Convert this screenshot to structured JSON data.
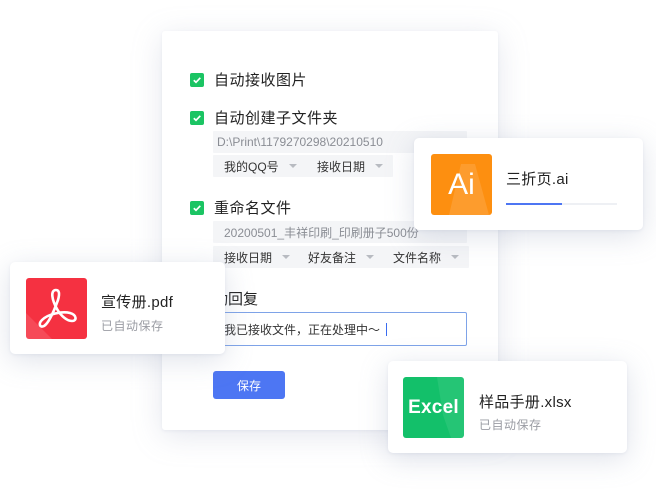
{
  "settings": {
    "auto_receive_images": {
      "label": "自动接收图片",
      "checked": true
    },
    "auto_create_subfolder": {
      "label": "自动创建子文件夹",
      "checked": true,
      "path_value": "D:\\Print\\1179270298\\20210510",
      "dropdowns": [
        {
          "label": "我的QQ号"
        },
        {
          "label": "接收日期"
        }
      ]
    },
    "rename_file": {
      "label": "重命名文件",
      "checked": true,
      "name_preview": "20200501_丰祥印刷_印刷册子500份",
      "dropdowns": [
        {
          "label": "接收日期"
        },
        {
          "label": "好友备注"
        },
        {
          "label": "文件名称"
        }
      ]
    },
    "auto_reply": {
      "label": "自动回复",
      "input_value": "我已接收文件，正在处理中～"
    },
    "save_label": "保存"
  },
  "files": {
    "ai": {
      "name": "三折页.ai",
      "icon_text": "Ai",
      "progress": 0.5,
      "color": "#fd8f10"
    },
    "pdf": {
      "name": "宣传册.pdf",
      "status": "已自动保存",
      "color": "#f53141"
    },
    "xlsx": {
      "name": "样品手册.xlsx",
      "icon_text": "Excel",
      "status": "已自动保存",
      "color": "#13c06a"
    }
  },
  "colors": {
    "checkbox": "#1bc463",
    "primary": "#4d76f3"
  }
}
